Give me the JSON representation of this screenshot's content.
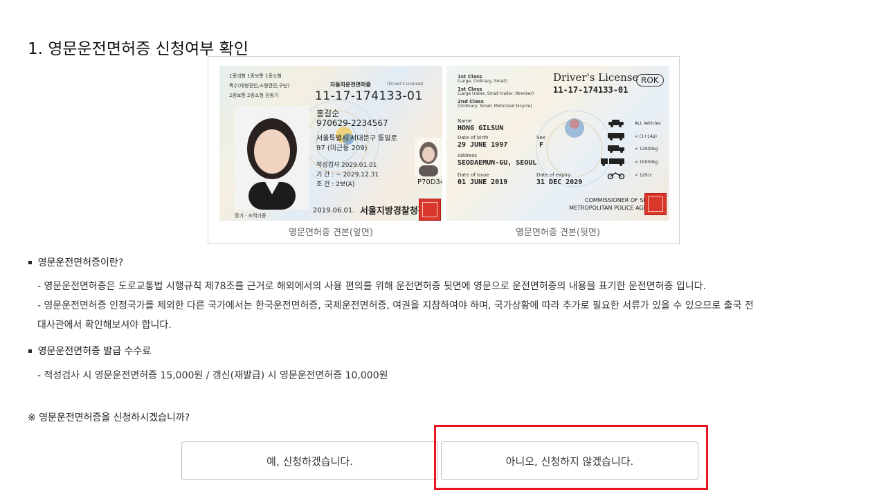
{
  "section": {
    "title": "1. 영문운전면허증 신청여부 확인"
  },
  "license_front": {
    "class_line1": "1종대형 1종보통 1종소형",
    "class_line2": "특수(대형견인,소형견인,구난)",
    "class_line3": "2종보통 2종소형 원동기",
    "doc_title": "자동차운전면허증",
    "doc_title_en": "(Driver's License)",
    "number": "11-17-174133-01",
    "name": "홍길순",
    "rrn": "970629-2234567",
    "address1": "서울특별시 서대문구 통일로",
    "address2": "97 (미근동 209)",
    "test_date": "적성검사    2029.01.01",
    "period": "기    간 : ~ 2029.12.31",
    "condition": "조    건 : 2보(A)",
    "serial": "P70D34",
    "issue_date": "2019.06.01.",
    "issuer": "서울지방경찰청장",
    "organ": "장기 · 조직기증",
    "caption": "영문면허증 견본(앞면)"
  },
  "license_back": {
    "title": "Driver's License",
    "country": "ROK",
    "number": "11-17-174133-01",
    "class1_title": "1st Class",
    "class1_desc": "(Large, Ordinary, Small)",
    "class1b_title": "1st Class",
    "class1b_desc": "(Large trailer, Small trailer, Wrecker)",
    "class2_title": "2nd Class",
    "class2_desc": "(Ordinary, Small, Motorized bicycle)",
    "name_label": "Name",
    "name": "HONG GILSUN",
    "dob_label": "Date of birth",
    "dob": "29 JUNE 1997",
    "sex_label": "Sex",
    "sex": "F",
    "address_label": "Address",
    "address": "SEODAEMUN-GU, SEOUL",
    "issue_label": "Date of issue",
    "issue": "01 JUNE 2019",
    "expiry_label": "Date of expiry",
    "expiry": "31 DEC 2029",
    "issuer1": "COMMISSIONER OF SEOUL",
    "issuer2": "METROPOLITAN POLICE AGENCY",
    "veh1": "ALL Vehicles",
    "veh2": "< (1+14p)",
    "veh3": "< 12000kg",
    "veh4": "< 10000kg",
    "veh5": "< 125cc",
    "caption": "영문면허증 견본(뒷면)"
  },
  "info": {
    "heading1": "영문운전면허증이란?",
    "line1": "- 영문운전면허증은 도로교통법 시행규칙 제78조를 근거로 해외에서의 사용 편의를 위해 운전면허증 뒷면에 영문으로 운전면허증의 내용을 표기한 운전면허증 입니다.",
    "line2": "- 영문운전면허증 인정국가를 제외한 다른 국가에서는 한국운전면허증, 국제운전면허증, 여권을 지참하여야 하며, 국가상황에 따라 추가로 필요한 서류가 있을 수 있으므로 출국 전",
    "line3": "대사관에서 확인해보셔야 합니다.",
    "heading2": "영문운전면허증 발급 수수료",
    "line4": "- 적성검사 시 영문운전면허증 15,000원 / 갱신(재발급) 시 영문운전면허증 10,000원"
  },
  "prompt": "※ 영문운전면허증을 신청하시겠습니까?",
  "buttons": {
    "yes": "예, 신청하겠습니다.",
    "no": "아니오, 신청하지 않겠습니다."
  },
  "colors": {
    "highlight": "#e8141f",
    "seal": "#d9372b"
  }
}
